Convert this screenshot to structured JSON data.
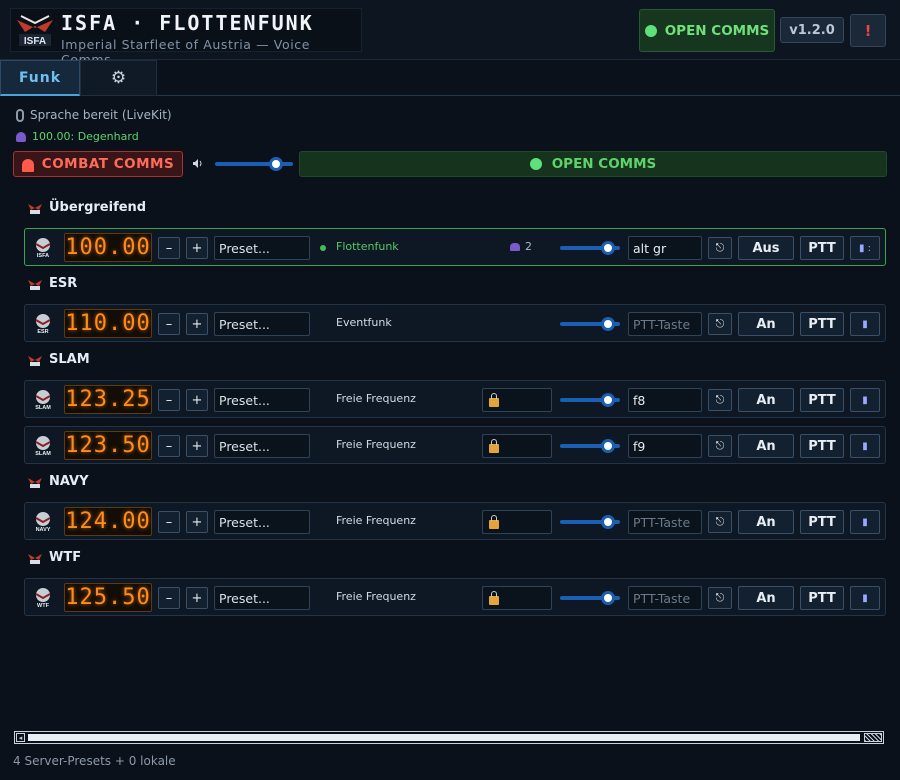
{
  "header": {
    "logo_text": "ISFA",
    "title": "ISFA · FLOTTENFUNK",
    "subtitle": "Imperial Starfleet of Austria — Voice Comms",
    "open_comms_label": "OPEN COMMS",
    "version": "v1.2.0",
    "warning_label": "!"
  },
  "tabs": [
    {
      "label": "Funk",
      "active": true
    },
    {
      "label": "⚙",
      "icon": "gear-icon",
      "active": false
    }
  ],
  "status": {
    "voice_ready": "Sprache bereit (LiveKit)",
    "user": "100.00: Degenhard"
  },
  "controls": {
    "combat_label": "COMBAT COMMS",
    "master_volume": 0.85,
    "open_comms_label": "OPEN COMMS"
  },
  "colors": {
    "accent_blue": "#1a5fb4",
    "frequency_orange": "#ff8c1a",
    "open_green": "#5ed36c",
    "combat_red": "#ff6b5b"
  },
  "sections": [
    {
      "name": "Übergreifend",
      "logo": "ISFA",
      "rows": [
        {
          "frequency": "100.00",
          "preset": "Preset...",
          "channel": "Flottenfunk",
          "active": true,
          "members": "2",
          "volume": 0.9,
          "ptt_key": "alt gr",
          "ptt_placeholder": "PTT-Taste",
          "toggle": "Aus",
          "ptt_label": "PTT",
          "extra": "▮ :"
        }
      ]
    },
    {
      "name": "ESR",
      "logo": "ESR",
      "rows": [
        {
          "frequency": "110.00",
          "preset": "Preset...",
          "channel": "Eventfunk",
          "active": false,
          "volume": 0.9,
          "ptt_key": "",
          "ptt_placeholder": "PTT-Taste",
          "toggle": "An",
          "ptt_label": "PTT",
          "extra": "▮"
        }
      ]
    },
    {
      "name": "SLAM",
      "logo": "SLAM",
      "rows": [
        {
          "frequency": "123.25",
          "preset": "Preset...",
          "channel": "Freie Frequenz",
          "active": false,
          "locked": true,
          "volume": 0.9,
          "ptt_key": "f8",
          "ptt_placeholder": "PTT-Taste",
          "toggle": "An",
          "ptt_label": "PTT",
          "extra": "▮"
        },
        {
          "frequency": "123.50",
          "preset": "Preset...",
          "channel": "Freie Frequenz",
          "active": false,
          "locked": true,
          "volume": 0.9,
          "ptt_key": "f9",
          "ptt_placeholder": "PTT-Taste",
          "toggle": "An",
          "ptt_label": "PTT",
          "extra": "▮"
        }
      ]
    },
    {
      "name": "NAVY",
      "logo": "NAVY",
      "rows": [
        {
          "frequency": "124.00",
          "preset": "Preset...",
          "channel": "Freie Frequenz",
          "active": false,
          "locked": true,
          "volume": 0.9,
          "ptt_key": "",
          "ptt_placeholder": "PTT-Taste",
          "toggle": "An",
          "ptt_label": "PTT",
          "extra": "▮"
        }
      ]
    },
    {
      "name": "WTF",
      "logo": "WTF",
      "rows": [
        {
          "frequency": "125.50",
          "preset": "Preset...",
          "channel": "Freie Frequenz",
          "active": false,
          "locked": true,
          "volume": 0.9,
          "ptt_key": "",
          "ptt_placeholder": "PTT-Taste",
          "toggle": "An",
          "ptt_label": "PTT",
          "extra": "▮"
        }
      ]
    }
  ],
  "footer": {
    "presets_summary": "4 Server-Presets + 0 lokale"
  }
}
